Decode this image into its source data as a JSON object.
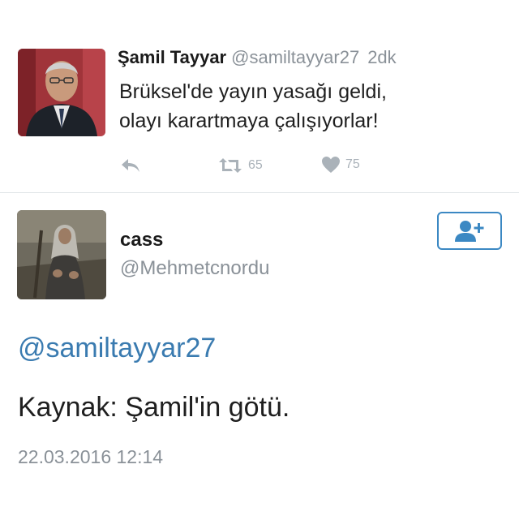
{
  "tweet1": {
    "name": "Şamil Tayyar",
    "handle": "@samiltayyar27",
    "time": "2dk",
    "text_lines": [
      "Brüksel'de yayın yasağı geldi,",
      "olayı karartmaya çalışıyorlar!"
    ],
    "actions": {
      "reply_icon": "reply-arrow-icon",
      "retweet_icon": "retweet-icon",
      "retweet_count": "65",
      "like_icon": "heart-icon",
      "like_count": "75"
    }
  },
  "tweet2": {
    "name": "cass",
    "handle": "@Mehmetcnordu",
    "follow_icon": "add-user-icon",
    "mention": "@samiltayyar27",
    "text": "Kaynak: Şamil'in götü.",
    "timestamp": "22.03.2016 12:14"
  },
  "colors": {
    "link": "#3a7bb0",
    "muted": "#8a9198",
    "action": "#aab2b9",
    "follow_border": "#3b88c3"
  }
}
